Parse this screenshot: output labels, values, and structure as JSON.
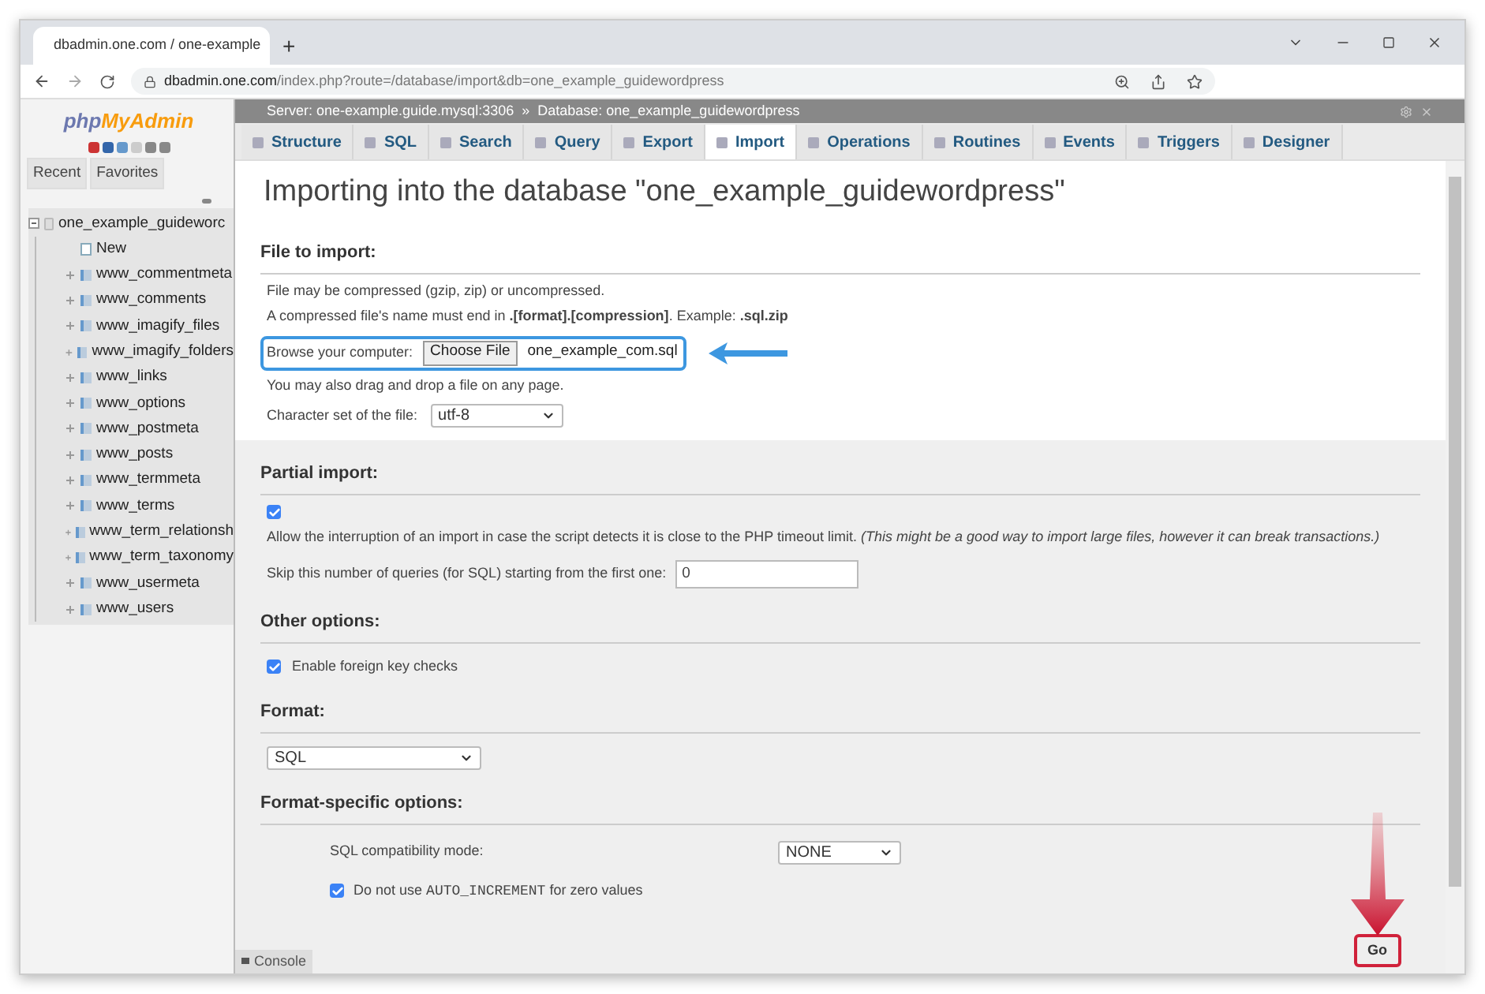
{
  "browser": {
    "tab_title": "dbadmin.one.com / one-example",
    "new_tab": "+",
    "url_host": "dbadmin.one.com",
    "url_path": "/index.php?route=/database/import&db=one_example_guidewordpress"
  },
  "sidebar": {
    "logo": {
      "prefix": "php",
      "main": "MyAdmin"
    },
    "tabs": [
      {
        "label": "Recent"
      },
      {
        "label": "Favorites"
      }
    ],
    "tree": [
      {
        "label": "one_example_guideworc",
        "expanded": true,
        "children": [
          {
            "label": "New",
            "kind": "new"
          },
          {
            "label": "www_commentmeta",
            "kind": "table"
          },
          {
            "label": "www_comments",
            "kind": "table"
          },
          {
            "label": "www_imagify_files",
            "kind": "table"
          },
          {
            "label": "www_imagify_folders",
            "kind": "table"
          },
          {
            "label": "www_links",
            "kind": "table"
          },
          {
            "label": "www_options",
            "kind": "table"
          },
          {
            "label": "www_postmeta",
            "kind": "table"
          },
          {
            "label": "www_posts",
            "kind": "table"
          },
          {
            "label": "www_termmeta",
            "kind": "table"
          },
          {
            "label": "www_terms",
            "kind": "table"
          },
          {
            "label": "www_term_relationsh",
            "kind": "table"
          },
          {
            "label": "www_term_taxonomy",
            "kind": "table"
          },
          {
            "label": "www_usermeta",
            "kind": "table"
          },
          {
            "label": "www_users",
            "kind": "table"
          }
        ]
      }
    ]
  },
  "breadcrumb": {
    "server": "Server: one-example.guide.mysql:3306",
    "separator": "»",
    "database": "Database: one_example_guidewordpress"
  },
  "tabs": [
    {
      "label": "Structure",
      "selected": false
    },
    {
      "label": "SQL",
      "selected": false
    },
    {
      "label": "Search",
      "selected": false
    },
    {
      "label": "Query",
      "selected": false
    },
    {
      "label": "Export",
      "selected": false
    },
    {
      "label": "Import",
      "selected": true
    },
    {
      "label": "Operations",
      "selected": false
    },
    {
      "label": "Routines",
      "selected": false
    },
    {
      "label": "Events",
      "selected": false
    },
    {
      "label": "Triggers",
      "selected": false
    },
    {
      "label": "Designer",
      "selected": false
    }
  ],
  "heading": "Importing into the database \"one_example_guidewordpress\"",
  "file_to_import": {
    "title": "File to import:",
    "note_1": "File may be compressed (gzip, zip) or uncompressed.",
    "note_2": "A compressed file's name must end in **.[format].[compression]**. Example: **.sql.zip**",
    "browse_label": "Browse your computer:",
    "choose_button": "Choose File",
    "file_name": "one_example_com.sql",
    "drag_note": "You may also drag and drop a file on any page.",
    "charset_label": "Character set of the file:",
    "charset_value": "utf-8"
  },
  "partial_import": {
    "title": "Partial import:",
    "allow_interrupt": {
      "checked": true,
      "label": "Allow the interruption of an import in case the script detects it is close to the PHP timeout limit.",
      "hint": "(This might be a good way to import large files, however it can break transactions.)"
    },
    "skip_label": "Skip this number of queries (for SQL) starting from the first one:",
    "skip_value": "0"
  },
  "other_options": {
    "title": "Other options:",
    "foreign_key_checks": {
      "checked": true,
      "label": "Enable foreign key checks"
    }
  },
  "format": {
    "title": "Format:",
    "value": "SQL"
  },
  "format_specific": {
    "title": "Format-specific options:",
    "compat_label": "SQL compatibility mode:",
    "compat_value": "NONE",
    "no_auto_increment": {
      "checked": true,
      "before": "Do not use",
      "code": "AUTO_INCREMENT",
      "after": "for zero values"
    }
  },
  "console": "Console",
  "go_button": "Go"
}
